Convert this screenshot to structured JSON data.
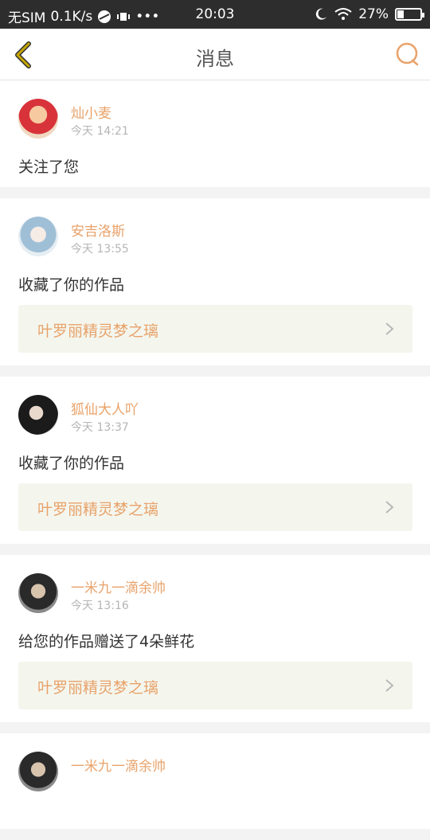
{
  "status_bar": {
    "carrier": "无SIM",
    "speed": "0.1K/s",
    "time": "20:03",
    "battery": "27%",
    "battery_level": 0.27
  },
  "nav": {
    "title": "消息",
    "back_icon": "chevron-left-icon",
    "search_icon": "search-icon"
  },
  "colors": {
    "accent": "#e8a26a",
    "back_icon": "#c8a800"
  },
  "messages": [
    {
      "user": "灿小麦",
      "time": "今天 14:21",
      "action": "关注了您"
    },
    {
      "user": "安吉洛斯",
      "time": "今天 13:55",
      "action": "收藏了你的作品",
      "work": "叶罗丽精灵梦之璃"
    },
    {
      "user": "狐仙大人吖",
      "time": "今天 13:37",
      "action": "收藏了你的作品",
      "work": "叶罗丽精灵梦之璃"
    },
    {
      "user": "一米九一滴余帅",
      "time": "今天 13:16",
      "action": "给您的作品赠送了4朵鲜花",
      "work": "叶罗丽精灵梦之璃"
    },
    {
      "user": "一米九一滴余帅"
    }
  ]
}
